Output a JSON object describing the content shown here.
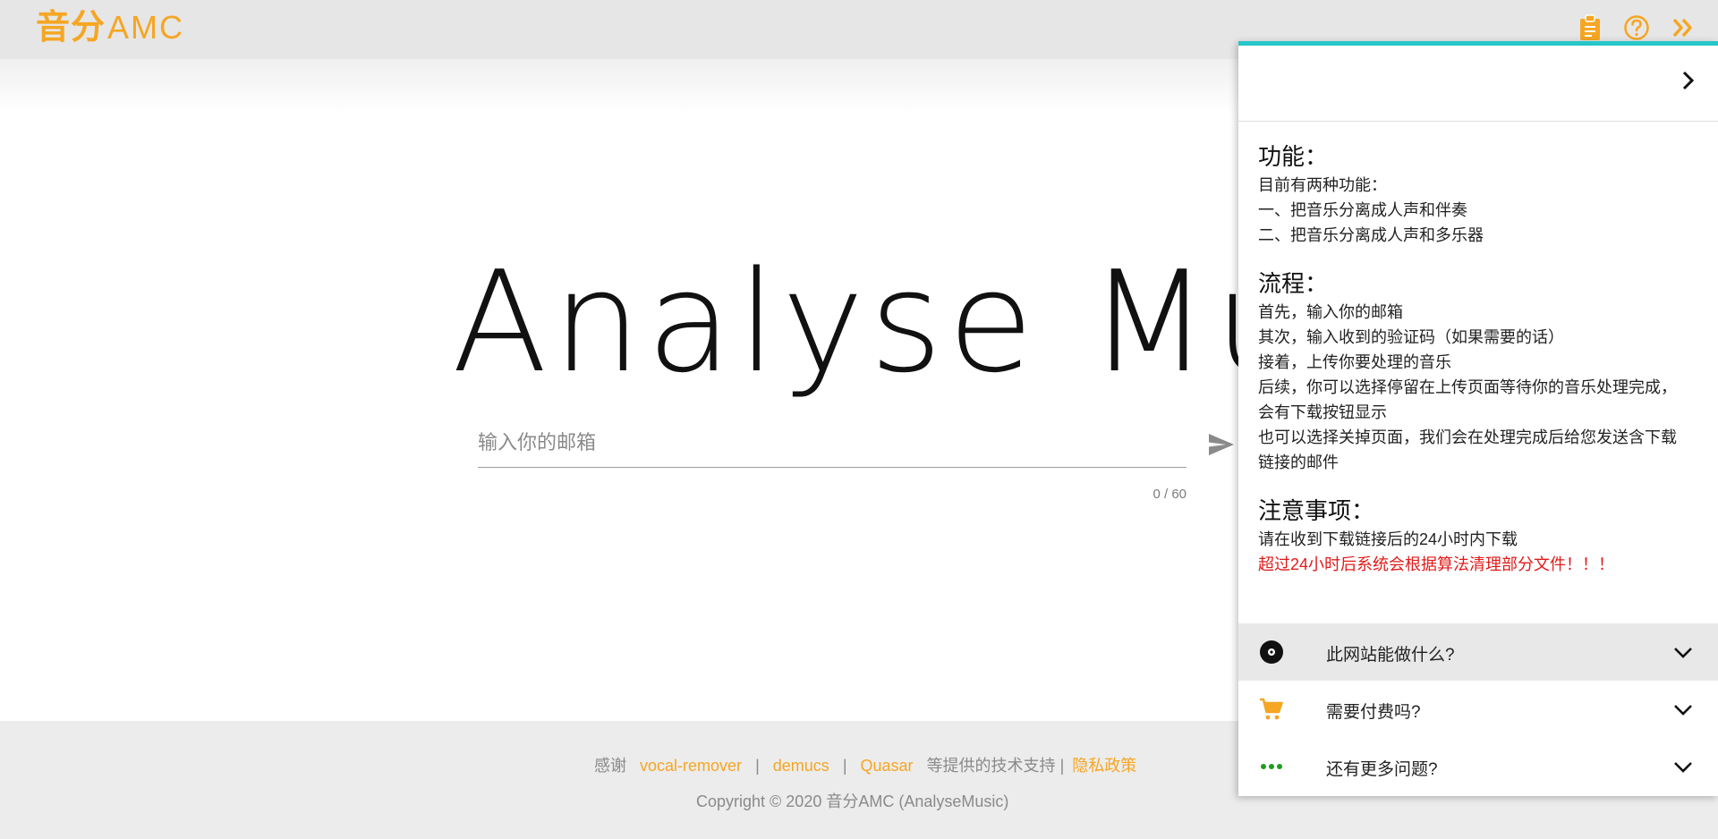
{
  "header": {
    "logo_cn": "音分",
    "logo_en": "AMC",
    "icons": [
      "clipboard-icon",
      "help-circle-icon",
      "double-chevron-right-icon"
    ],
    "accent_color": "#f5a623"
  },
  "main": {
    "title": "Analyse Music",
    "email_placeholder": "输入你的邮箱",
    "counter": "0 / 60"
  },
  "footer": {
    "thanks": "感谢",
    "link1": "vocal-remover",
    "link2": "demucs",
    "link3": "Quasar",
    "suffix": "等提供的技术支持 |",
    "privacy": "隐私政策",
    "sep": "|",
    "copyright": "Copyright © 2020 音分AMC (AnalyseMusic)"
  },
  "drawer": {
    "accent_color": "#26c6c9",
    "sections": [
      {
        "title": "功能：",
        "lines": [
          "目前有两种功能：",
          "一、把音乐分离成人声和伴奏",
          "二、把音乐分离成人声和多乐器"
        ]
      },
      {
        "title": "流程：",
        "lines": [
          "首先，输入你的邮箱",
          "其次，输入收到的验证码（如果需要的话）",
          "接着，上传你要处理的音乐",
          "后续，你可以选择停留在上传页面等待你的音乐处理完成，",
          "会有下载按钮显示",
          "也可以选择关掉页面，我们会在处理完成后给您发送含下载",
          "链接的邮件"
        ]
      },
      {
        "title": "注意事项：",
        "lines": [
          "请在收到下载链接后的24小时内下载"
        ],
        "warning": "超过24小时后系统会根据算法清理部分文件！！！"
      }
    ],
    "faq": [
      {
        "label": "此网站能做什么?",
        "icon": "disc-icon"
      },
      {
        "label": "需要付费吗?",
        "icon": "cart-icon"
      },
      {
        "label": "还有更多问题?",
        "icon": "more-dots-icon"
      }
    ]
  }
}
